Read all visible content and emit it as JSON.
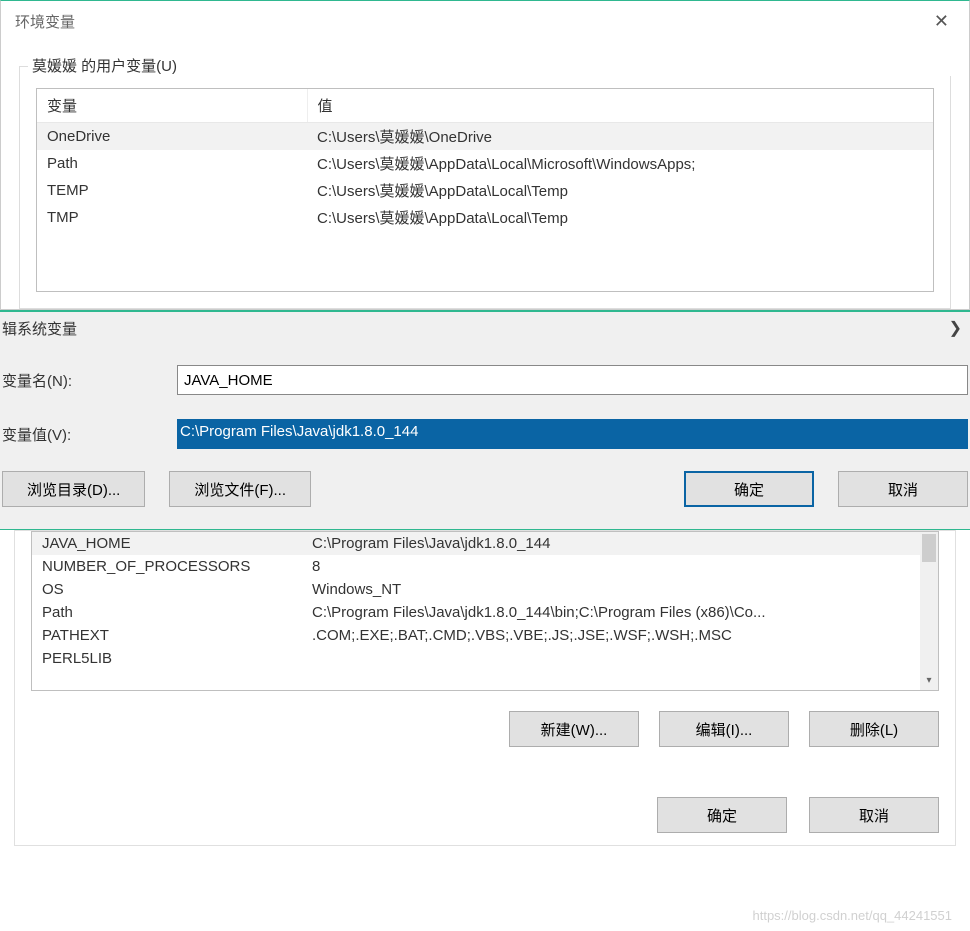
{
  "topDialog": {
    "title": "环境变量",
    "userVarsLabel": "莫媛媛 的用户变量(U)",
    "columns": {
      "name": "变量",
      "value": "值"
    },
    "rows": [
      {
        "name": "OneDrive",
        "value": "C:\\Users\\莫媛媛\\OneDrive",
        "selected": true
      },
      {
        "name": "Path",
        "value": "C:\\Users\\莫媛媛\\AppData\\Local\\Microsoft\\WindowsApps;"
      },
      {
        "name": "TEMP",
        "value": "C:\\Users\\莫媛媛\\AppData\\Local\\Temp"
      },
      {
        "name": "TMP",
        "value": "C:\\Users\\莫媛媛\\AppData\\Local\\Temp"
      }
    ]
  },
  "editDialog": {
    "title": "辑系统变量",
    "nameLabel": "变量名(N):",
    "nameValue": "JAVA_HOME",
    "valueLabel": "变量值(V):",
    "valueValue": "C:\\Program Files\\Java\\jdk1.8.0_144",
    "buttons": {
      "browseDir": "浏览目录(D)...",
      "browseFile": "浏览文件(F)...",
      "ok": "确定",
      "cancel": "取消"
    }
  },
  "sysVars": {
    "rows": [
      {
        "name": "JAVA_HOME",
        "value": "C:\\Program Files\\Java\\jdk1.8.0_144",
        "selected": true
      },
      {
        "name": "NUMBER_OF_PROCESSORS",
        "value": "8"
      },
      {
        "name": "OS",
        "value": "Windows_NT"
      },
      {
        "name": "Path",
        "value": "C:\\Program Files\\Java\\jdk1.8.0_144\\bin;C:\\Program Files (x86)\\Co..."
      },
      {
        "name": "PATHEXT",
        "value": ".COM;.EXE;.BAT;.CMD;.VBS;.VBE;.JS;.JSE;.WSF;.WSH;.MSC"
      },
      {
        "name": "PERL5LIB",
        "value": ""
      }
    ],
    "buttons": {
      "new": "新建(W)...",
      "edit": "编辑(I)...",
      "delete": "删除(L)"
    }
  },
  "footer": {
    "ok": "确定",
    "cancel": "取消"
  },
  "watermark": "https://blog.csdn.net/qq_44241551"
}
